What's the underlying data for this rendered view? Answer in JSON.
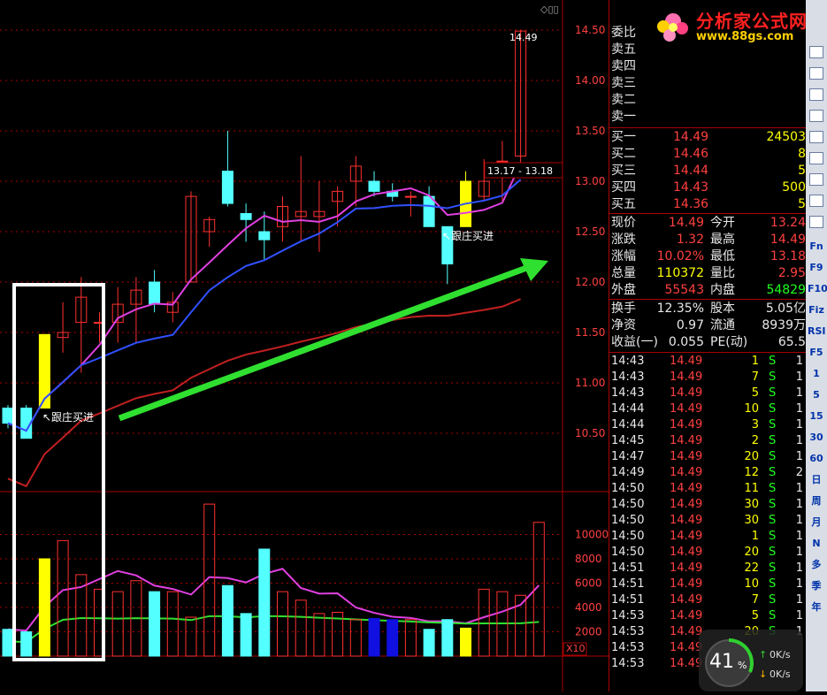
{
  "chart_data": {
    "type": "candlestick",
    "price_axis": [
      14.5,
      14.0,
      13.5,
      13.0,
      12.5,
      12.0,
      11.5,
      11.0,
      10.5
    ],
    "volume_axis": [
      10000,
      8000,
      6000,
      4000,
      2000
    ],
    "volume_multiplier": "X10",
    "candles": [
      {
        "o": 10.75,
        "h": 10.78,
        "l": 10.55,
        "c": 10.6,
        "dir": "down"
      },
      {
        "o": 10.75,
        "h": 10.78,
        "l": 10.45,
        "c": 10.45,
        "dir": "down"
      },
      {
        "o": 10.75,
        "h": 11.48,
        "l": 10.75,
        "c": 11.48,
        "dir": "up",
        "highlight": true
      },
      {
        "o": 11.45,
        "h": 11.8,
        "l": 11.3,
        "c": 11.5,
        "dir": "up"
      },
      {
        "o": 11.6,
        "h": 12.05,
        "l": 11.1,
        "c": 11.85,
        "dir": "up"
      },
      {
        "o": 11.6,
        "h": 11.7,
        "l": 11.4,
        "c": 11.6,
        "dir": "up"
      },
      {
        "o": 11.6,
        "h": 11.95,
        "l": 11.4,
        "c": 11.78,
        "dir": "up"
      },
      {
        "o": 11.78,
        "h": 12.05,
        "l": 11.4,
        "c": 11.92,
        "dir": "up"
      },
      {
        "o": 12.0,
        "h": 12.12,
        "l": 11.7,
        "c": 11.78,
        "dir": "down"
      },
      {
        "o": 11.7,
        "h": 11.9,
        "l": 11.6,
        "c": 11.8,
        "dir": "up"
      },
      {
        "o": 12.0,
        "h": 12.9,
        "l": 12.0,
        "c": 12.85,
        "dir": "up"
      },
      {
        "o": 12.5,
        "h": 12.65,
        "l": 12.35,
        "c": 12.62,
        "dir": "up"
      },
      {
        "o": 13.1,
        "h": 13.5,
        "l": 12.75,
        "c": 12.78,
        "dir": "down"
      },
      {
        "o": 12.68,
        "h": 12.78,
        "l": 12.4,
        "c": 12.62,
        "dir": "down"
      },
      {
        "o": 12.5,
        "h": 12.7,
        "l": 12.22,
        "c": 12.42,
        "dir": "down"
      },
      {
        "o": 12.75,
        "h": 12.85,
        "l": 12.4,
        "c": 12.55,
        "dir": "up"
      },
      {
        "o": 12.65,
        "h": 13.25,
        "l": 12.4,
        "c": 12.7,
        "dir": "up"
      },
      {
        "o": 12.65,
        "h": 13.0,
        "l": 12.3,
        "c": 12.7,
        "dir": "up"
      },
      {
        "o": 12.8,
        "h": 12.95,
        "l": 12.55,
        "c": 12.9,
        "dir": "up"
      },
      {
        "o": 13.0,
        "h": 13.25,
        "l": 12.75,
        "c": 13.15,
        "dir": "up"
      },
      {
        "o": 13.0,
        "h": 13.1,
        "l": 12.85,
        "c": 12.9,
        "dir": "down"
      },
      {
        "o": 12.9,
        "h": 12.98,
        "l": 12.8,
        "c": 12.85,
        "dir": "down"
      },
      {
        "o": 12.85,
        "h": 12.9,
        "l": 12.65,
        "c": 12.85,
        "dir": "up"
      },
      {
        "o": 12.85,
        "h": 12.95,
        "l": 12.55,
        "c": 12.55,
        "dir": "down"
      },
      {
        "o": 12.55,
        "h": 12.55,
        "l": 11.98,
        "c": 12.18,
        "dir": "down"
      },
      {
        "o": 12.55,
        "h": 13.1,
        "l": 12.55,
        "c": 13.0,
        "dir": "up",
        "highlight": true
      },
      {
        "o": 12.85,
        "h": 13.22,
        "l": 12.8,
        "c": 13.0,
        "dir": "up"
      },
      {
        "o": 13.2,
        "h": 13.4,
        "l": 12.8,
        "c": 13.2,
        "dir": "up"
      },
      {
        "o": 13.25,
        "h": 14.5,
        "l": 13.18,
        "c": 14.49,
        "dir": "up"
      }
    ],
    "volumes": [
      2200,
      2000,
      8000,
      9500,
      6700,
      5500,
      5300,
      6200,
      5300,
      5300,
      3200,
      12500,
      5800,
      3500,
      8800,
      5300,
      4600,
      3500,
      3600,
      3000,
      3100,
      3000,
      3000,
      2200,
      3000,
      2300,
      5500,
      5300,
      5000,
      11000
    ],
    "annotations": {
      "follow_label": "跟庄买进",
      "price_high_label": "14.49",
      "range_label": "13.17 - 13.18"
    }
  },
  "quote_panel": {
    "order_book_sell": [
      "委比",
      "卖五",
      "卖四",
      "卖三",
      "卖二",
      "卖一"
    ],
    "order_book_buy": [
      {
        "label": "买一",
        "price": "14.49",
        "vol": "24503"
      },
      {
        "label": "买二",
        "price": "14.46",
        "vol": "8"
      },
      {
        "label": "买三",
        "price": "14.44",
        "vol": "5"
      },
      {
        "label": "买四",
        "price": "14.43",
        "vol": "500"
      },
      {
        "label": "买五",
        "price": "14.36",
        "vol": "5"
      }
    ],
    "stats": [
      {
        "l1": "现价",
        "v1": "14.49",
        "c1": "red",
        "l2": "今开",
        "v2": "13.24",
        "c2": "red"
      },
      {
        "l1": "涨跌",
        "v1": "1.32",
        "c1": "red",
        "l2": "最高",
        "v2": "14.49",
        "c2": "red"
      },
      {
        "l1": "涨幅",
        "v1": "10.02%",
        "c1": "red",
        "l2": "最低",
        "v2": "13.18",
        "c2": "red"
      },
      {
        "l1": "总量",
        "v1": "110372",
        "c1": "yel",
        "l2": "量比",
        "v2": "2.95",
        "c2": "red"
      },
      {
        "l1": "外盘",
        "v1": "55543",
        "c1": "red",
        "l2": "内盘",
        "v2": "54829",
        "c2": "grn"
      }
    ],
    "stats2": [
      {
        "l1": "换手",
        "v1": "12.35%",
        "l2": "股本",
        "v2": "5.05亿"
      },
      {
        "l1": "净资",
        "v1": "0.97",
        "l2": "流通",
        "v2": "8939万"
      },
      {
        "l1": "收益(一)",
        "v1": "0.055",
        "l2": "PE(动)",
        "v2": "65.5"
      }
    ],
    "ticks": [
      {
        "t": "14:43",
        "p": "14.49",
        "v": "1",
        "s": "S",
        "n": "1"
      },
      {
        "t": "14:43",
        "p": "14.49",
        "v": "7",
        "s": "S",
        "n": "1"
      },
      {
        "t": "14:43",
        "p": "14.49",
        "v": "5",
        "s": "S",
        "n": "1"
      },
      {
        "t": "14:44",
        "p": "14.49",
        "v": "10",
        "s": "S",
        "n": "1"
      },
      {
        "t": "14:44",
        "p": "14.49",
        "v": "3",
        "s": "S",
        "n": "1"
      },
      {
        "t": "14:45",
        "p": "14.49",
        "v": "2",
        "s": "S",
        "n": "1"
      },
      {
        "t": "14:47",
        "p": "14.49",
        "v": "20",
        "s": "S",
        "n": "1"
      },
      {
        "t": "14:49",
        "p": "14.49",
        "v": "12",
        "s": "S",
        "n": "2"
      },
      {
        "t": "14:50",
        "p": "14.49",
        "v": "11",
        "s": "S",
        "n": "1"
      },
      {
        "t": "14:50",
        "p": "14.49",
        "v": "30",
        "s": "S",
        "n": "1"
      },
      {
        "t": "14:50",
        "p": "14.49",
        "v": "30",
        "s": "S",
        "n": "1"
      },
      {
        "t": "14:50",
        "p": "14.49",
        "v": "1",
        "s": "S",
        "n": "1"
      },
      {
        "t": "14:50",
        "p": "14.49",
        "v": "20",
        "s": "S",
        "n": "1"
      },
      {
        "t": "14:51",
        "p": "14.49",
        "v": "22",
        "s": "S",
        "n": "1"
      },
      {
        "t": "14:51",
        "p": "14.49",
        "v": "10",
        "s": "S",
        "n": "1"
      },
      {
        "t": "14:51",
        "p": "14.49",
        "v": "7",
        "s": "S",
        "n": "1"
      },
      {
        "t": "14:53",
        "p": "14.49",
        "v": "5",
        "s": "S",
        "n": "1"
      },
      {
        "t": "14:53",
        "p": "14.49",
        "v": "20",
        "s": "S",
        "n": "1"
      },
      {
        "t": "14:53",
        "p": "14.49",
        "v": "",
        "s": "",
        "n": ""
      },
      {
        "t": "14:53",
        "p": "14.49",
        "v": "",
        "s": "",
        "n": ""
      }
    ]
  },
  "toolbar": {
    "items": [
      "Fn",
      "F9",
      "F10",
      "Fiz",
      "RSI",
      "F5",
      "1",
      "5",
      "15",
      "30",
      "60",
      "日",
      "周",
      "月",
      "N",
      "多",
      "季",
      "年"
    ]
  },
  "logo": {
    "name": "分析家公式网",
    "url": "www.88gs.com"
  },
  "gauge": {
    "percent": "41",
    "unit": "%",
    "up": "0K/s",
    "down": "0K/s"
  },
  "colors": {
    "up": "#ff3030",
    "down": "#54ffff",
    "highlight": "#ffff00",
    "ma_magenta": "#e040e0",
    "ma_blue": "#3050ff",
    "ma_red": "#c02020",
    "arrow": "#30e030",
    "box": "#ffffff"
  }
}
